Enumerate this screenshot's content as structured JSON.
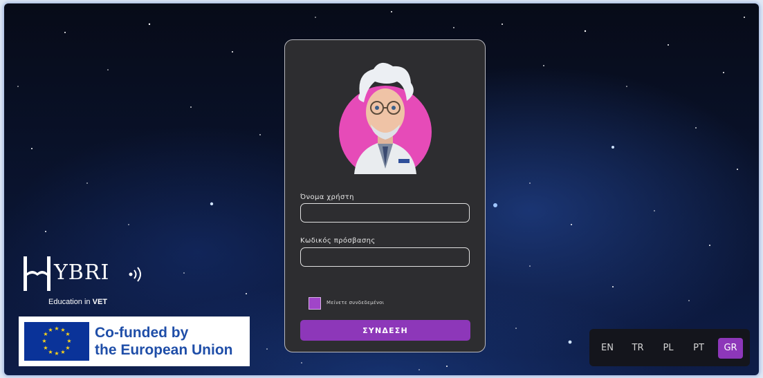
{
  "login": {
    "username_label": "Όνομα χρήστη",
    "username_value": "",
    "password_label": "Κωδικός πρόσβασης",
    "password_value": "",
    "remember_label": "Μείνετε συνδεδεμένοι",
    "remember_checked": false,
    "submit_label": "ΣΥΝΔΕΣΗ"
  },
  "branding": {
    "logo_text": "YBRI",
    "tagline_prefix": "Education in ",
    "tagline_bold": "VET",
    "eu_line1": "Co-funded by",
    "eu_line2": "the European Union"
  },
  "languages": {
    "items": [
      "EN",
      "TR",
      "PL",
      "PT",
      "GR"
    ],
    "selected": "GR"
  },
  "icons": {
    "avatar": "scientist-avatar-icon",
    "logo": "hybrid-book-logo-icon",
    "flag": "eu-flag-icon"
  },
  "colors": {
    "accent": "#8d37b9",
    "avatar_circle": "#e64bb8",
    "card_bg": "#2d2d30"
  }
}
